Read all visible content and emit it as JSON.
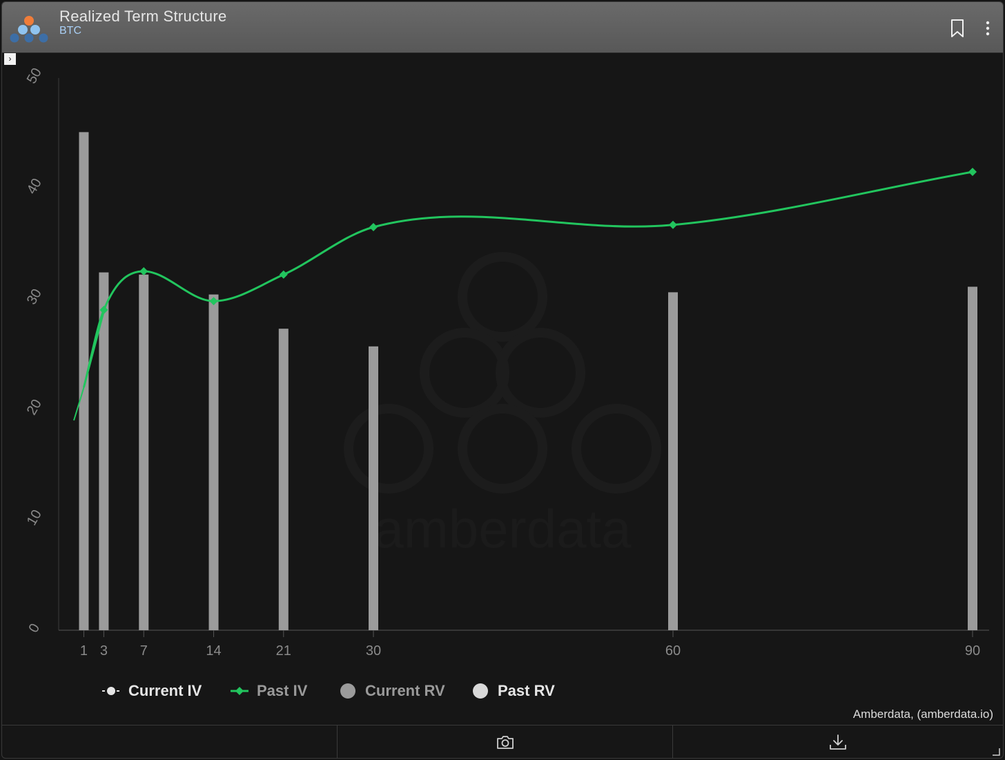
{
  "header": {
    "title": "Realized Term Structure",
    "subtitle": "BTC"
  },
  "icons": {
    "logo": "amberdata-logo-icon",
    "bookmark": "bookmark-icon",
    "more": "more-vertical-icon",
    "expand": "chevron-right-icon",
    "camera": "camera-icon",
    "download": "download-icon",
    "resize": "resize-handle-icon"
  },
  "expand_toggle": "›",
  "watermark": "amberdata",
  "credit": "Amberdata, (amberdata.io)",
  "colors": {
    "background": "#161616",
    "header": "#5f5f5f",
    "past_iv": "#22c55e",
    "current_iv": "#e6e6e6",
    "current_rv": "#9b9b9b",
    "past_rv": "#d9d9d9",
    "axis_text": "#8a8a8a",
    "subtitle": "#a9cff5"
  },
  "legend": [
    {
      "label": "Current IV",
      "color": "#e6e6e6",
      "marker": "line-circle"
    },
    {
      "label": "Past IV",
      "color": "#9a9a9a",
      "marker": "line-diamond",
      "marker_color": "#22c55e"
    },
    {
      "label": "Current RV",
      "color": "#9a9a9a",
      "marker": "circle",
      "marker_color": "#9b9b9b"
    },
    {
      "label": "Past RV",
      "color": "#e6e6e6",
      "marker": "circle",
      "marker_color": "#d9d9d9"
    }
  ],
  "chart_data": {
    "type": "bar",
    "title": "Realized Term Structure",
    "subtitle": "BTC",
    "x": [
      1,
      3,
      7,
      14,
      21,
      30,
      60,
      90
    ],
    "xlim": [
      0,
      90.5
    ],
    "ylim": [
      0,
      50
    ],
    "yticks": [
      0,
      10,
      20,
      30,
      40,
      50
    ],
    "grid": false,
    "legend_position": "bottom-left",
    "series": [
      {
        "name": "Current IV",
        "type": "line",
        "x": [
          0,
          1,
          3
        ],
        "values": [
          19,
          22,
          28.8
        ]
      },
      {
        "name": "Past IV",
        "type": "line",
        "markers": "diamond",
        "values": [
          22,
          29,
          32.5,
          29.8,
          32.2,
          36.5,
          36.7,
          41.5
        ]
      },
      {
        "name": "Past RV",
        "type": "bar",
        "values": [
          45.1,
          32.4,
          32.2,
          30.4,
          27.3,
          25.7,
          30.6,
          31.1
        ]
      }
    ]
  }
}
